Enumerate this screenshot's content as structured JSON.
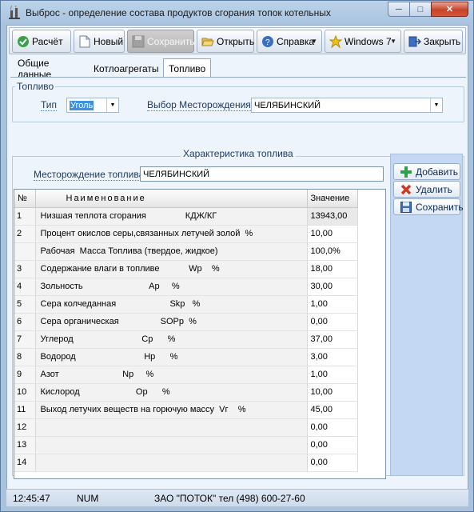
{
  "window": {
    "title": "Выброс - определение состава продуктов сгорания топок котельных"
  },
  "toolbar": {
    "calc": "Расчёт",
    "new": "Новый",
    "save": "Сохранить",
    "open": "Открыть",
    "help": "Справка",
    "windows": "Windows 7",
    "close": "Закрыть"
  },
  "tabs": [
    "Общие данные",
    "Котлоагрегаты",
    "Топливо"
  ],
  "fuel_group": {
    "title": "Топливо",
    "type_label": "Тип",
    "type_value": "Уголь",
    "deposit_label": "Выбор Месторождения",
    "deposit_value": "ЧЕЛЯБИНСКИЙ"
  },
  "characteristics": {
    "title": "Характеристика топлива",
    "deposit_label": "Месторождение топлива",
    "deposit_value": "ЧЕЛЯБИНСКИЙ"
  },
  "grid": {
    "headers": {
      "num": "№",
      "name": "Наименование",
      "value": "Значение"
    },
    "rows": [
      {
        "num": "1",
        "name": "Низшая теплота сгорания                КДЖ/КГ",
        "value": "13943,00"
      },
      {
        "num": "2",
        "name": "Процент окислов серы,связанных летучей золой  %",
        "value": "10,00"
      },
      {
        "num": "",
        "name": "Рабочая  Масса Топлива (твердое, жидкое)",
        "value": "100,0%"
      },
      {
        "num": "3",
        "name": "Содержание влаги в топливе            Wp    %",
        "value": "18,00"
      },
      {
        "num": "4",
        "name": "Зольность                           Ap     %",
        "value": "30,00"
      },
      {
        "num": "5",
        "name": "Сера колчеданная                      Skp   %",
        "value": "1,00"
      },
      {
        "num": "6",
        "name": "Сера органическая                 SOPp  %",
        "value": "0,00"
      },
      {
        "num": "7",
        "name": "Углерод                            Cp      %",
        "value": "37,00"
      },
      {
        "num": "8",
        "name": "Водород                            Hp      %",
        "value": "3,00"
      },
      {
        "num": "9",
        "name": "Азот                          Np     %",
        "value": "1,00"
      },
      {
        "num": "10",
        "name": "Кислород                       Op      %",
        "value": "10,00"
      },
      {
        "num": "11",
        "name": "Выход летучих веществ на горючую массу  Vг    %",
        "value": "45,00"
      },
      {
        "num": "12",
        "name": "",
        "value": "0,00"
      },
      {
        "num": "13",
        "name": "",
        "value": "0,00"
      },
      {
        "num": "14",
        "name": "",
        "value": "0,00"
      }
    ]
  },
  "side_buttons": {
    "add": "Добавить",
    "delete": "Удалить",
    "save": "Сохранить"
  },
  "status": {
    "time": "12:45:47",
    "num": "NUM",
    "company": "ЗАО \"ПОТОК\" тел (498) 600-27-60"
  },
  "colors": {
    "accent": "#3d8fe0",
    "frame": "#a9c3df",
    "client": "#eef4fb",
    "side_panel": "#c4d8f3"
  }
}
